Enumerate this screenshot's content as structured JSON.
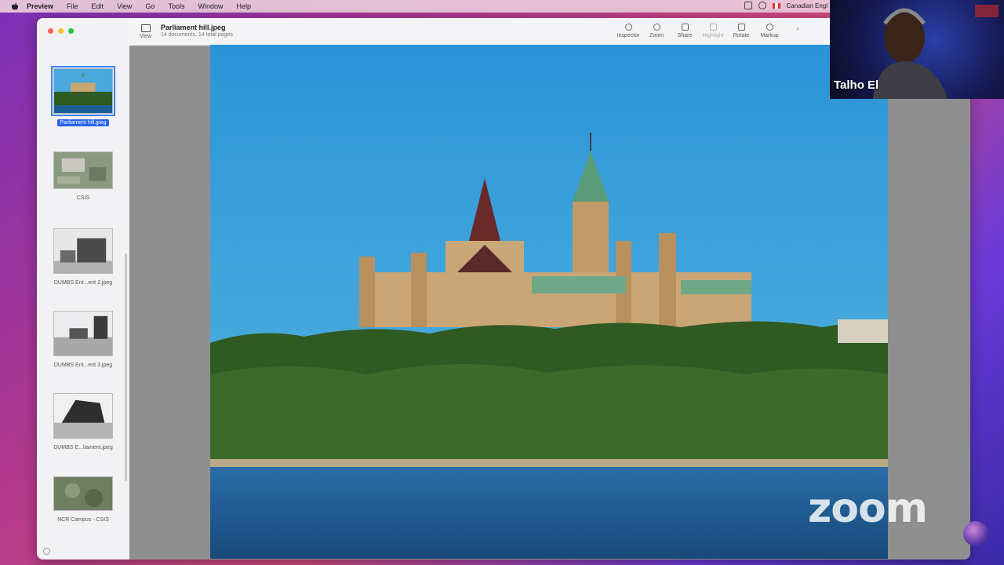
{
  "menubar": {
    "app": "Preview",
    "items": [
      "File",
      "Edit",
      "View",
      "Go",
      "Tools",
      "Window",
      "Help"
    ],
    "input_source": "Canadian Engl"
  },
  "window": {
    "title": "Parliament hill.jpeg",
    "subtitle": "14 documents, 14 total pages",
    "view_label": "View",
    "tools": [
      {
        "label": "Inspector",
        "icon": "info-icon",
        "enabled": true
      },
      {
        "label": "Zoom",
        "icon": "zoom-icon",
        "enabled": true
      },
      {
        "label": "Share",
        "icon": "share-icon",
        "enabled": true
      },
      {
        "label": "Highlight",
        "icon": "highlight-icon",
        "enabled": false
      },
      {
        "label": "Rotate",
        "icon": "rotate-icon",
        "enabled": true
      },
      {
        "label": "Markup",
        "icon": "markup-icon",
        "enabled": true
      }
    ]
  },
  "sidebar": {
    "thumbnails": [
      {
        "label": "Parliament hill.jpeg",
        "selected": true,
        "kind": "parliament"
      },
      {
        "label": "CSIS",
        "selected": false,
        "kind": "aerial"
      },
      {
        "label": "DUMBS Ent...ent 2.jpeg",
        "selected": false,
        "kind": "entrance2"
      },
      {
        "label": "DUMBS Ent...ent 3.jpeg",
        "selected": false,
        "kind": "entrance3"
      },
      {
        "label": "DUMBS E...liament.jpeg",
        "selected": false,
        "kind": "bunker"
      },
      {
        "label": "NCR Campus - CSIS",
        "selected": false,
        "kind": "map"
      }
    ]
  },
  "webcam": {
    "name": "Talho El"
  },
  "overlay": {
    "zoom_brand": "zoom"
  },
  "colors": {
    "selection": "#2563eb",
    "sky": "#3fa3d6",
    "water": "#1d5c93",
    "forest": "#2f5a22"
  }
}
